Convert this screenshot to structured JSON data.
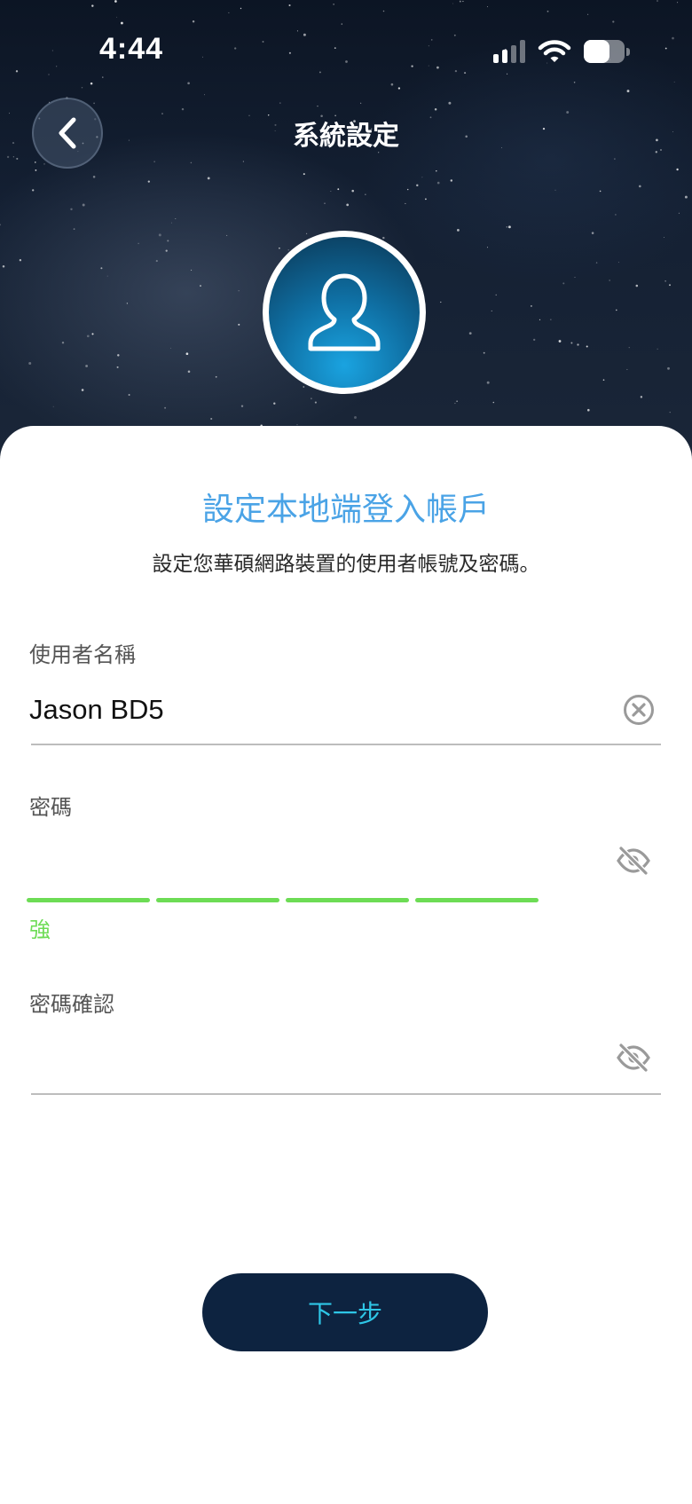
{
  "status_bar": {
    "time": "4:44",
    "signal_bars": 4,
    "signal_active": 2,
    "battery_level": 0.62
  },
  "nav": {
    "title": "系統設定"
  },
  "sheet": {
    "heading": "設定本地端登入帳戶",
    "subtitle": "設定您華碩網路裝置的使用者帳號及密碼。"
  },
  "form": {
    "username": {
      "label": "使用者名稱",
      "value": "Jason BD5"
    },
    "password": {
      "label": "密碼",
      "value": "",
      "strength_label": "強",
      "strength_segments_filled": 4,
      "strength_color": "#6ddc55"
    },
    "confirm": {
      "label": "密碼確認",
      "value": ""
    }
  },
  "next_button": {
    "label": "下一步"
  },
  "colors": {
    "accent_blue": "#4aa3e6",
    "button_bg": "#0d2340",
    "button_text": "#2ec6e6"
  }
}
